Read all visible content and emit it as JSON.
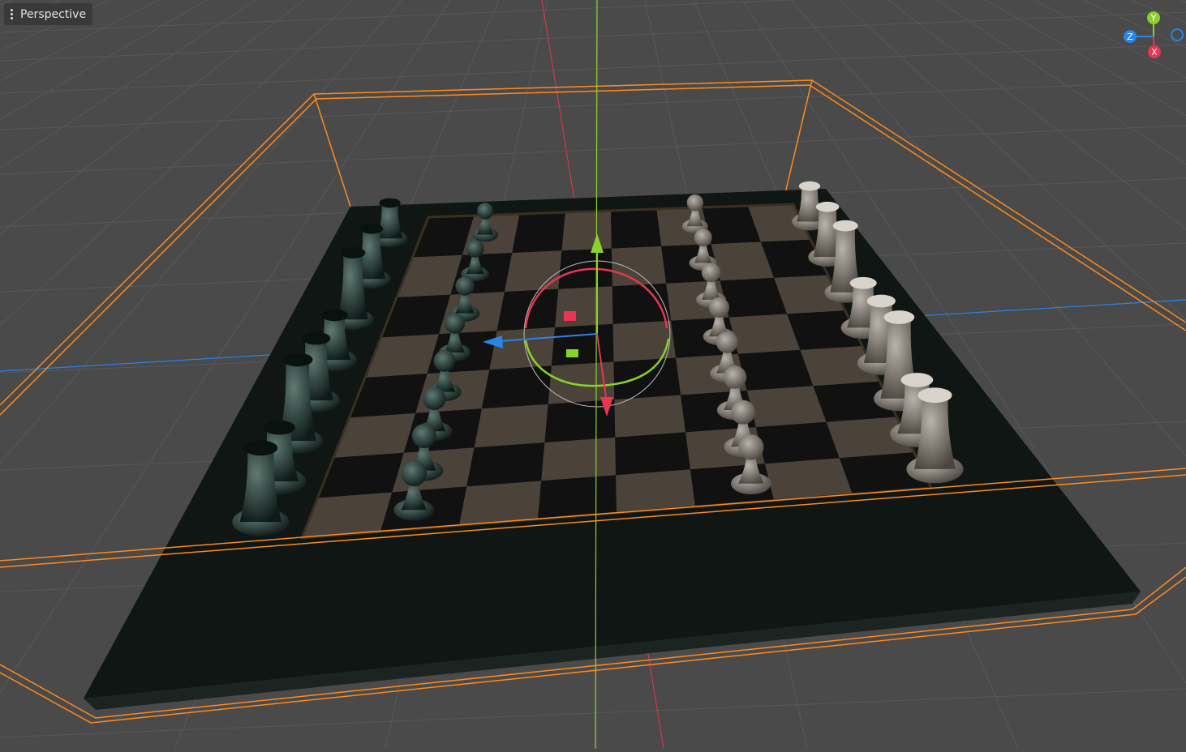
{
  "viewport": {
    "view_mode": "Perspective",
    "menu_icon": "vertical-dots-icon"
  },
  "orientation_gizmo": {
    "y_label": "Y",
    "z_label": "Z",
    "x_label": "X"
  },
  "colors": {
    "background": "#4a4a4a",
    "grid": "#5a5a5a",
    "x_axis": "#e8364f",
    "y_axis": "#8ad22a",
    "z_axis": "#2c83e8",
    "selection": "#ff8a1e",
    "board_frame": "#0f1614",
    "light_square": "#4b433a",
    "dark_square": "#111111"
  },
  "scene": {
    "object": "chess-board",
    "selected": true
  }
}
